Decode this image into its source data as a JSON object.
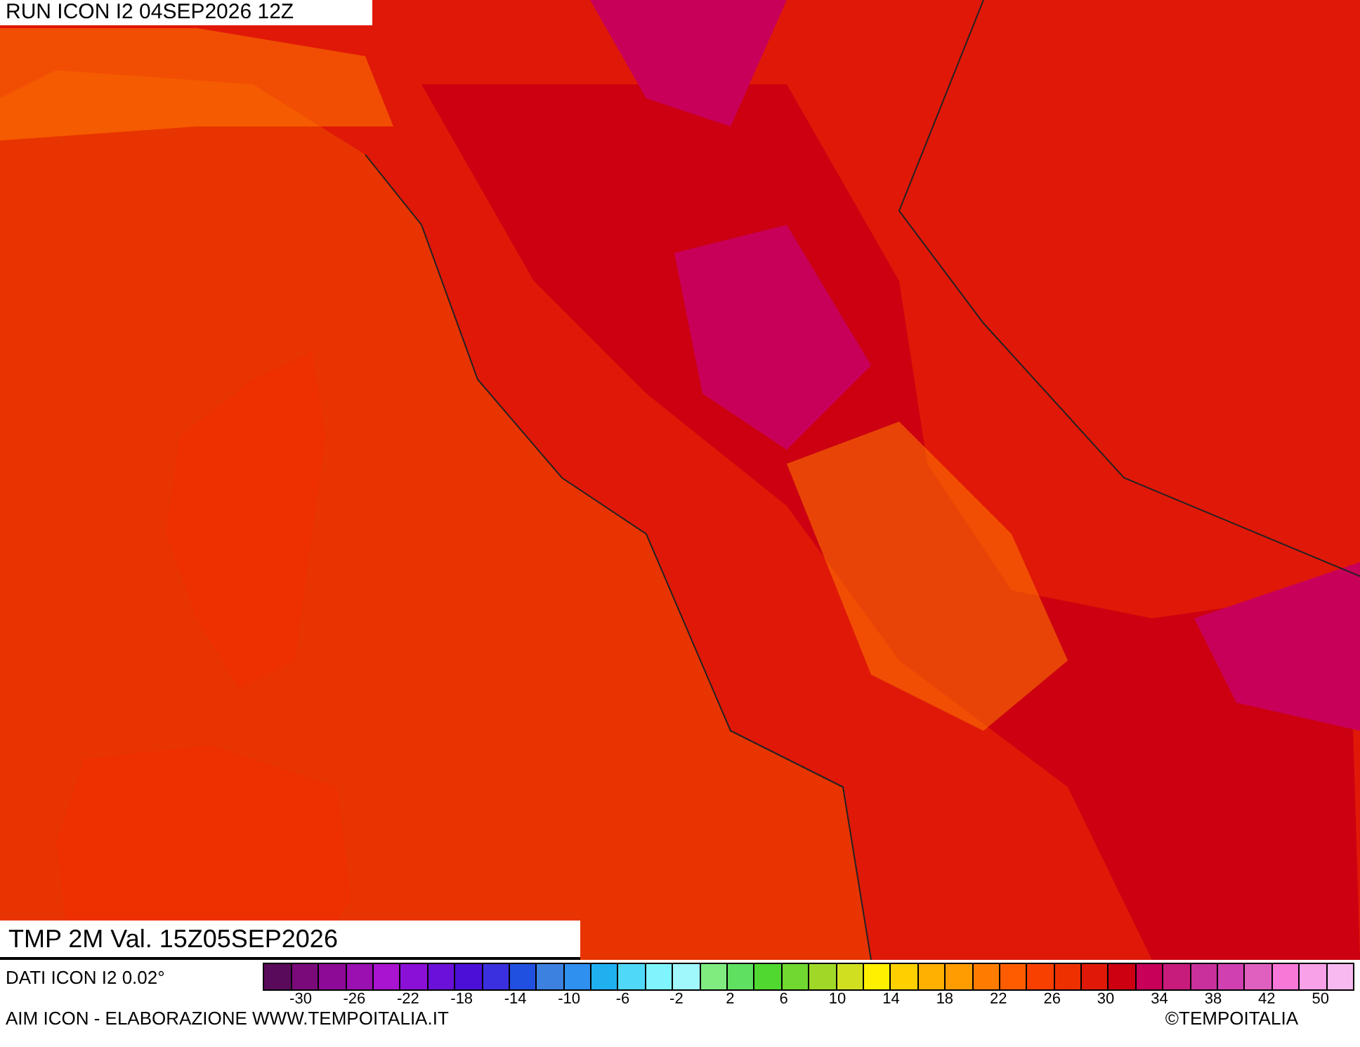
{
  "run_label": "RUN ICON I2 04SEP2026 12Z",
  "valid_label": "TMP 2M Val. 15Z05SEP2026",
  "data_source": "DATI ICON I2 0.02°",
  "credit": "AIM ICON - ELABORAZIONE WWW.TEMPOITALIA.IT",
  "copyright": "©TEMPOITALIA",
  "scale": {
    "swatches": [
      {
        "color": "#5a0a5a"
      },
      {
        "color": "#7a0a7a"
      },
      {
        "color": "#8c0a96"
      },
      {
        "color": "#9a10b0"
      },
      {
        "color": "#a814d0"
      },
      {
        "color": "#8a10d8"
      },
      {
        "color": "#6a10d8"
      },
      {
        "color": "#4a10d8"
      },
      {
        "color": "#3a30e0"
      },
      {
        "color": "#2050e0"
      },
      {
        "color": "#3c80e0"
      },
      {
        "color": "#3090f0"
      },
      {
        "color": "#20b0f0"
      },
      {
        "color": "#50d8f8"
      },
      {
        "color": "#80f4fc"
      },
      {
        "color": "#a0f8fc"
      },
      {
        "color": "#80ec80"
      },
      {
        "color": "#60e060"
      },
      {
        "color": "#50d830"
      },
      {
        "color": "#70d830"
      },
      {
        "color": "#a0d828"
      },
      {
        "color": "#d0e020"
      },
      {
        "color": "#fff000"
      },
      {
        "color": "#ffd000"
      },
      {
        "color": "#ffb000"
      },
      {
        "color": "#ff9c00"
      },
      {
        "color": "#ff7c00"
      },
      {
        "color": "#ff5c00"
      },
      {
        "color": "#f84000"
      },
      {
        "color": "#ee3000"
      },
      {
        "color": "#e01808"
      },
      {
        "color": "#cc0010"
      },
      {
        "color": "#c8005a"
      },
      {
        "color": "#c81c7c"
      },
      {
        "color": "#c8309c"
      },
      {
        "color": "#d040b0"
      },
      {
        "color": "#e060c0"
      },
      {
        "color": "#f878d8"
      },
      {
        "color": "#f8a0e8"
      },
      {
        "color": "#f8b8f0"
      }
    ],
    "labels": [
      "-30",
      "-26",
      "-22",
      "-18",
      "-14",
      "-10",
      "-6",
      "-2",
      "2",
      "6",
      "10",
      "14",
      "18",
      "22",
      "26",
      "30",
      "34",
      "38",
      "42",
      "50"
    ]
  }
}
